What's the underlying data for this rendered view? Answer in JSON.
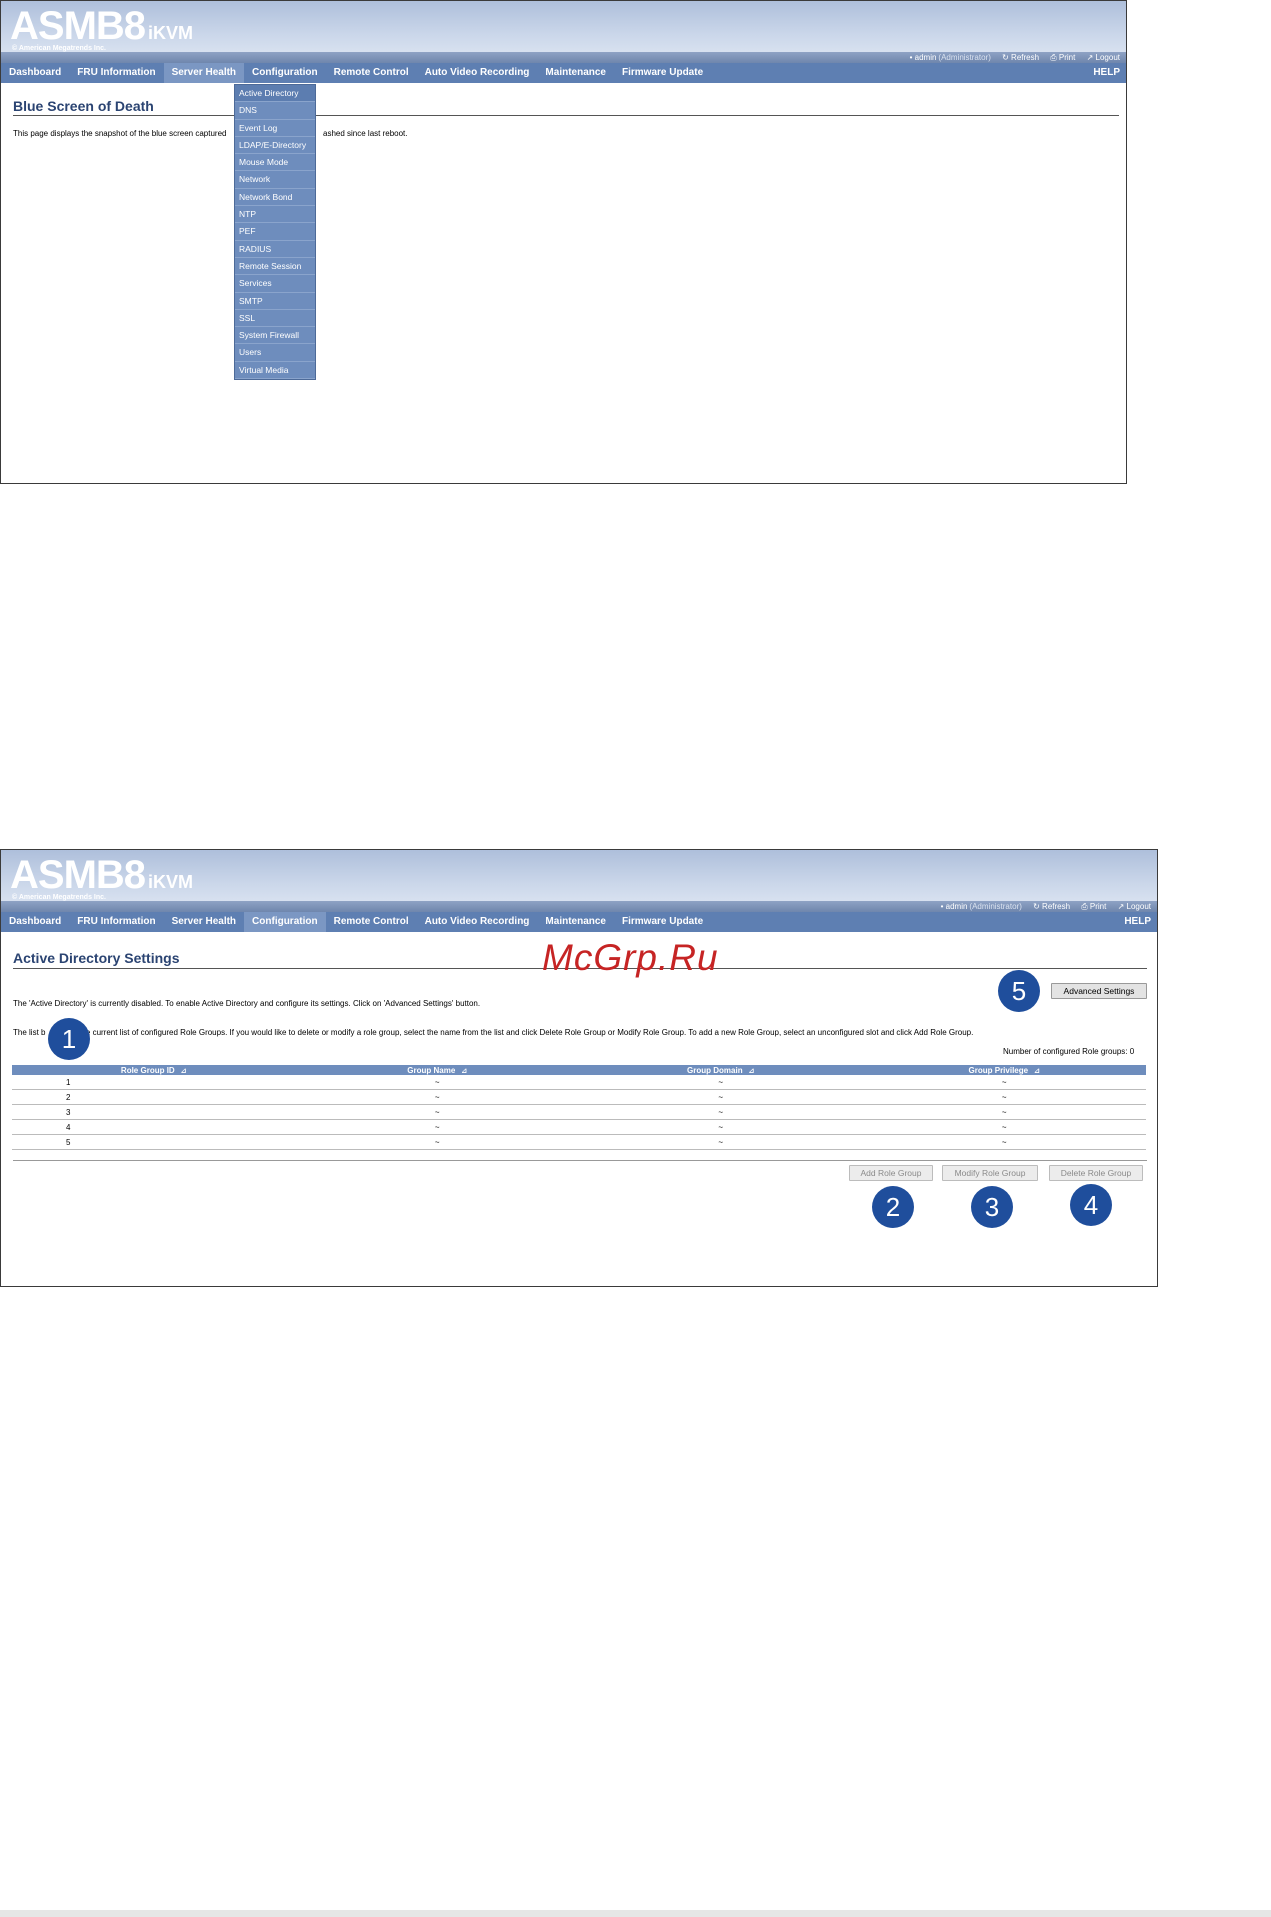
{
  "header": {
    "logo_main": "ASMB8",
    "logo_sub": "iKVM",
    "logo_copyright": "© American Megatrends Inc.",
    "user": "• admin",
    "role": "(Administrator)",
    "refresh": "↻ Refresh",
    "print": "⎙ Print",
    "logout": "↗ Logout"
  },
  "nav": {
    "items": [
      "Dashboard",
      "FRU Information",
      "Server Health",
      "Configuration",
      "Remote Control",
      "Auto Video Recording",
      "Maintenance",
      "Firmware Update"
    ],
    "help": "HELP"
  },
  "screen1": {
    "title": "Blue Screen of Death",
    "desc_left": "This page displays the snapshot of the blue screen captured",
    "desc_right": "ashed since last reboot.",
    "active_nav": "Server Health",
    "dropdown": [
      "Active Directory",
      "DNS",
      "Event Log",
      "LDAP/E-Directory",
      "Mouse Mode",
      "Network",
      "Network Bond",
      "NTP",
      "PEF",
      "RADIUS",
      "Remote Session",
      "Services",
      "SMTP",
      "SSL",
      "System Firewall",
      "Users",
      "Virtual Media"
    ]
  },
  "screen2": {
    "title": "Active Directory Settings",
    "active_nav": "Configuration",
    "status_text": "The 'Active Directory' is currently disabled. To enable Active Directory and configure its settings. Click on 'Advanced Settings' button.",
    "list_text_left": "The list b",
    "list_text_right": "s the current list of configured Role Groups. If you would like to delete or modify a role group, select the name from the list and click Delete Role Group or Modify Role Group. To add a new Role Group, select an unconfigured slot and click Add Role Group.",
    "count_text": "Number of configured Role groups: 0",
    "advanced_button": "Advanced Settings",
    "columns": [
      "Role Group ID",
      "Group Name",
      "Group Domain",
      "Group Privilege"
    ],
    "rows": [
      [
        "1",
        "~",
        "~",
        "~"
      ],
      [
        "2",
        "~",
        "~",
        "~"
      ],
      [
        "3",
        "~",
        "~",
        "~"
      ],
      [
        "4",
        "~",
        "~",
        "~"
      ],
      [
        "5",
        "~",
        "~",
        "~"
      ]
    ],
    "add_button": "Add Role Group",
    "modify_button": "Modify Role Group",
    "delete_button": "Delete Role Group",
    "callouts": [
      "1",
      "2",
      "3",
      "4",
      "5"
    ]
  },
  "watermark": "McGrp.Ru",
  "colors": {
    "nav": "#5e7fb2",
    "title": "#2b4472",
    "callout": "#1f4e9c",
    "watermark": "#c62424"
  }
}
